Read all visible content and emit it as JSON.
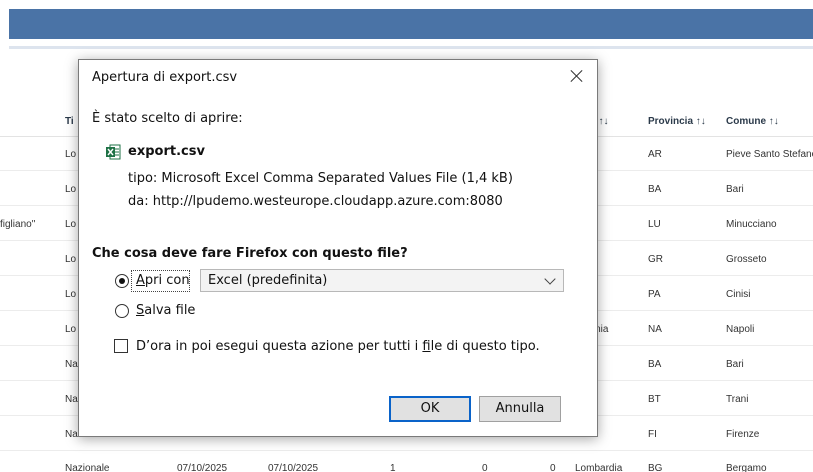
{
  "background": {
    "headers": [
      {
        "key": "tipo",
        "label": "Ti"
      },
      {
        "key": "regione",
        "label": "ne ↑↓"
      },
      {
        "key": "provincia",
        "label": "Provincia ↑↓"
      },
      {
        "key": "comune",
        "label": "Comune ↑↓"
      }
    ],
    "rows": [
      {
        "extra": "",
        "tipo": "Lo",
        "regione": "na",
        "provincia": "AR",
        "comune": "Pieve Santo Stefano"
      },
      {
        "extra": "",
        "tipo": "Lo",
        "regione": "a",
        "provincia": "BA",
        "comune": "Bari"
      },
      {
        "extra": "figliano\"",
        "tipo": "Lo",
        "regione": "na",
        "provincia": "LU",
        "comune": "Minucciano"
      },
      {
        "extra": "",
        "tipo": "Lo",
        "regione": "na",
        "provincia": "GR",
        "comune": "Grosseto"
      },
      {
        "extra": "",
        "tipo": "Lo",
        "regione": "",
        "provincia": "PA",
        "comune": "Cinisi"
      },
      {
        "extra": "",
        "tipo": "Lo",
        "regione": "pania",
        "provincia": "NA",
        "comune": "Napoli"
      },
      {
        "extra": "",
        "tipo": "Na",
        "regione": "a",
        "provincia": "BA",
        "comune": "Bari"
      },
      {
        "extra": "",
        "tipo": "Na",
        "regione": "a",
        "provincia": "BT",
        "comune": "Trani"
      },
      {
        "extra": "",
        "tipo": "Na",
        "regione": "na",
        "provincia": "FI",
        "comune": "Firenze"
      }
    ],
    "last_row": {
      "tipo": "Nazionale",
      "data1": "07/10/2025",
      "data2": "07/10/2025",
      "n1": "1",
      "n2": "0",
      "n3": "0",
      "regione": "Lombardia",
      "provincia": "BG",
      "comune": "Bergamo"
    }
  },
  "dialog": {
    "title": "Apertura di export.csv",
    "chosen_text": "È stato scelto di aprire:",
    "file_icon": "excel-csv-icon",
    "filename": "export.csv",
    "type_line": "tipo:  Microsoft Excel Comma Separated Values File (1,4 kB)",
    "from_line": "da:  http://lpudemo.westeurope.cloudapp.azure.com:8080",
    "question": "Che cosa deve fare Firefox con questo file?",
    "open_with": {
      "pre": "",
      "underlined": "A",
      "post": "pri con",
      "checked": true
    },
    "app_select": "Excel (predefinita)",
    "save_file": {
      "pre": "",
      "underlined": "S",
      "post": "alva file",
      "checked": false
    },
    "remember": {
      "pre": "D’ora in poi esegui questa azione per tutti i ",
      "underlined": "f",
      "post": "ile di questo tipo.",
      "checked": false
    },
    "ok_label": "OK",
    "cancel_label": "Annulla"
  },
  "colors": {
    "topbar": "#4a73a6",
    "excel_green": "#1e7145",
    "ok_border": "#0a63c9"
  }
}
